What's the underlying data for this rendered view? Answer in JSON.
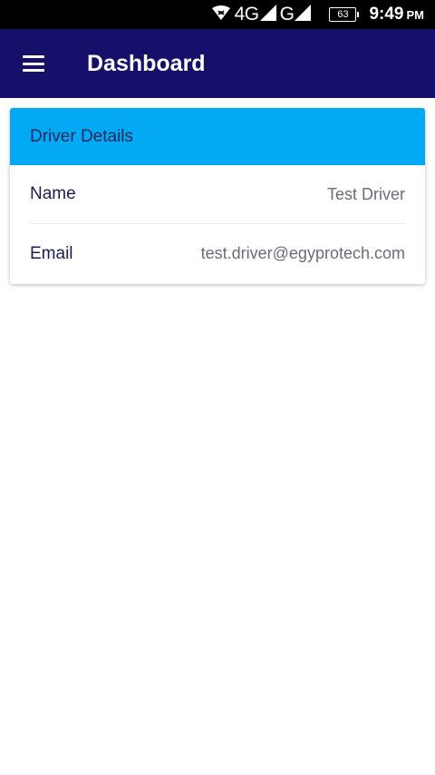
{
  "status_bar": {
    "network_1": "4G",
    "network_2": "G",
    "battery_level": "63",
    "time": "9:49",
    "ampm": "PM"
  },
  "app_bar": {
    "title": "Dashboard",
    "menu_icon": "hamburger-menu-icon"
  },
  "card": {
    "title": "Driver Details",
    "rows": [
      {
        "label": "Name",
        "value": "Test Driver"
      },
      {
        "label": "Email",
        "value": "test.driver@egyprotech.com"
      }
    ]
  },
  "colors": {
    "app_bar": "#17106b",
    "card_header": "#03a9f4",
    "status_bar": "#000000"
  }
}
